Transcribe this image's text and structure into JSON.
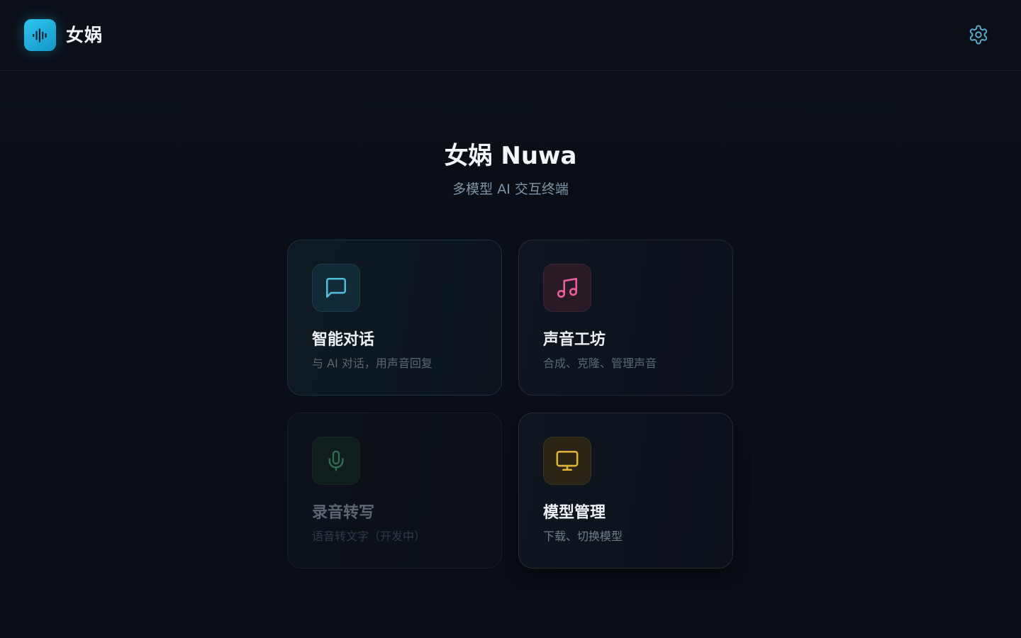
{
  "header": {
    "app_name": "女娲"
  },
  "hero": {
    "title": "女娲 Nuwa",
    "subtitle": "多模型 AI 交互终端"
  },
  "cards": [
    {
      "title": "智能对话",
      "description": "与 AI 对话，用声音回复",
      "icon": "chat-bubble-icon",
      "accent": "#4fbcd8"
    },
    {
      "title": "声音工坊",
      "description": "合成、克隆、管理声音",
      "icon": "music-note-icon",
      "accent": "#ec5f9b"
    },
    {
      "title": "录音转写",
      "description": "语音转文字（开发中）",
      "icon": "microphone-icon",
      "accent": "#2f6b52"
    },
    {
      "title": "模型管理",
      "description": "下载、切换模型",
      "icon": "monitor-icon",
      "accent": "#e0b43a"
    }
  ],
  "icons": {
    "logo": "waveform-icon",
    "settings": "gear-icon"
  },
  "colors": {
    "background": "#0a0e16",
    "logo_gradient_start": "#2ec5ef",
    "logo_gradient_end": "#1596c8",
    "settings_icon": "#5aa9c9"
  }
}
